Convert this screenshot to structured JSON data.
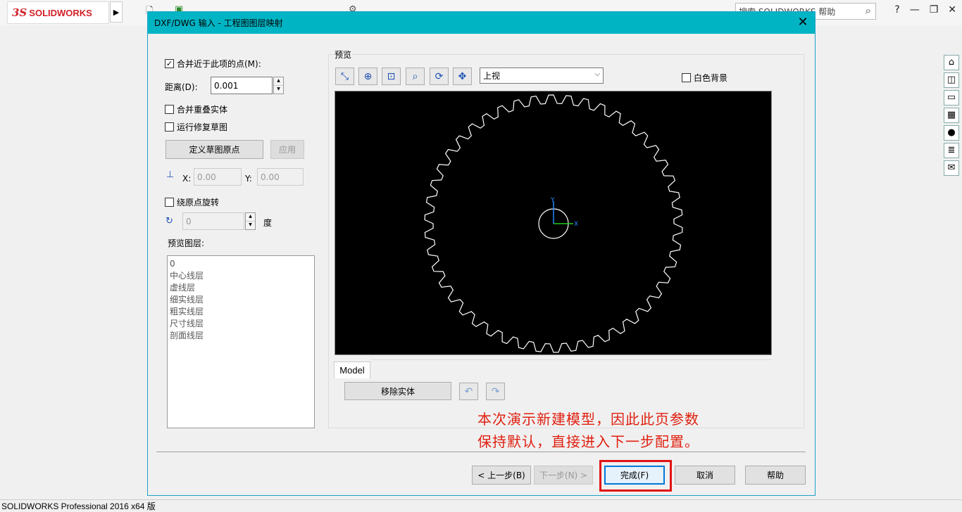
{
  "app": {
    "logo_ds": "3S",
    "logo_text": "SOLIDWORKS",
    "search_placeholder": "搜索 SOLIDWORKS 帮助",
    "help_label": "?",
    "status": "SOLIDWORKS Professional 2016 x64 版"
  },
  "dialog": {
    "title": "DXF/DWG 输入 - 工程图图层映射",
    "close": "✕",
    "merge_points_label": "合并近于此项的点(M):",
    "merge_points_checked": true,
    "distance_label": "距离(D):",
    "distance_value": "0.001",
    "merge_overlap_label": "合并重叠实体",
    "run_repair_label": "运行修复草图",
    "define_origin_button": "定义草图原点",
    "apply_button": "应用",
    "x_label": "X:",
    "x_value": "0.00",
    "y_label": "Y:",
    "y_value": "0.00",
    "rotate_label": "绕原点旋转",
    "rotate_value": "0",
    "degree_label": "度",
    "preview_layers_label": "预览图层:",
    "layers": [
      "0",
      "中心线层",
      "虚线层",
      "细实线层",
      "粗实线层",
      "尺寸线层",
      "剖面线层"
    ],
    "preview_caption": "预览",
    "view_select": "上视",
    "white_bg_label": "白色背景",
    "model_tab": "Model",
    "remove_entity_button": "移除实体",
    "back_button": "< 上一步(B)",
    "next_button": "下一步(N) >",
    "finish_button": "完成(F)",
    "cancel_button": "取消",
    "help_button": "帮助"
  },
  "annotation": {
    "line1": "本次演示新建模型，因此此页参数",
    "line2": "保持默认，直接进入下一步配置。"
  },
  "colors": {
    "title_bar": "#00b4c4",
    "annotation": "#e02010",
    "highlight": "#e21313"
  }
}
